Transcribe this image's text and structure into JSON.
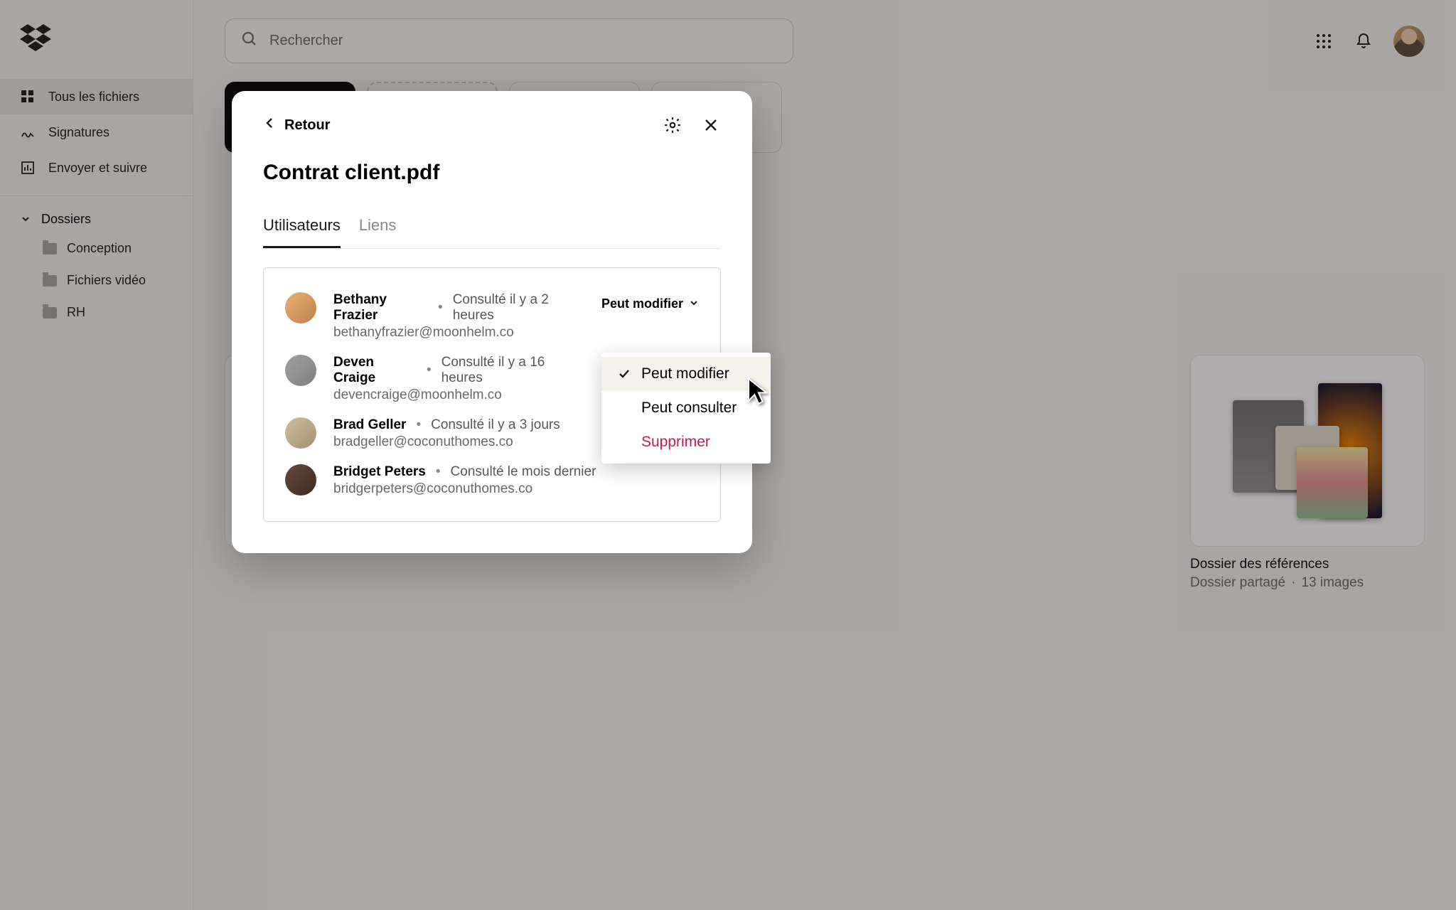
{
  "search": {
    "placeholder": "Rechercher"
  },
  "sidebar": {
    "nav": [
      {
        "label": "Tous les fichiers",
        "active": true
      },
      {
        "label": "Signatures"
      },
      {
        "label": "Envoyer et suivre"
      }
    ],
    "folders_header": "Dossiers",
    "folders": [
      {
        "label": "Conception"
      },
      {
        "label": "Fichiers vidéo"
      },
      {
        "label": "RH"
      }
    ]
  },
  "reference_card": {
    "title": "Dossier des références",
    "subtitle": "Dossier partagé",
    "count": "13 images"
  },
  "modal": {
    "back": "Retour",
    "title": "Contrat client.pdf",
    "tabs": {
      "users": "Utilisateurs",
      "links": "Liens"
    },
    "perm_label": "Peut modifier",
    "users": [
      {
        "name": "Bethany Frazier",
        "time": "Consulté il y a 2 heures",
        "email": "bethanyfrazier@moonhelm.co"
      },
      {
        "name": "Deven Craige",
        "time": "Consulté il y a 16 heures",
        "email": "devencraige@moonhelm.co"
      },
      {
        "name": "Brad Geller",
        "time": "Consulté il y a 3 jours",
        "email": "bradgeller@coconuthomes.co"
      },
      {
        "name": "Bridget Peters",
        "time": "Consulté le mois dernier",
        "email": "bridgerpeters@coconuthomes.co"
      }
    ],
    "dropdown": {
      "edit": "Peut modifier",
      "view": "Peut consulter",
      "remove": "Supprimer"
    }
  }
}
